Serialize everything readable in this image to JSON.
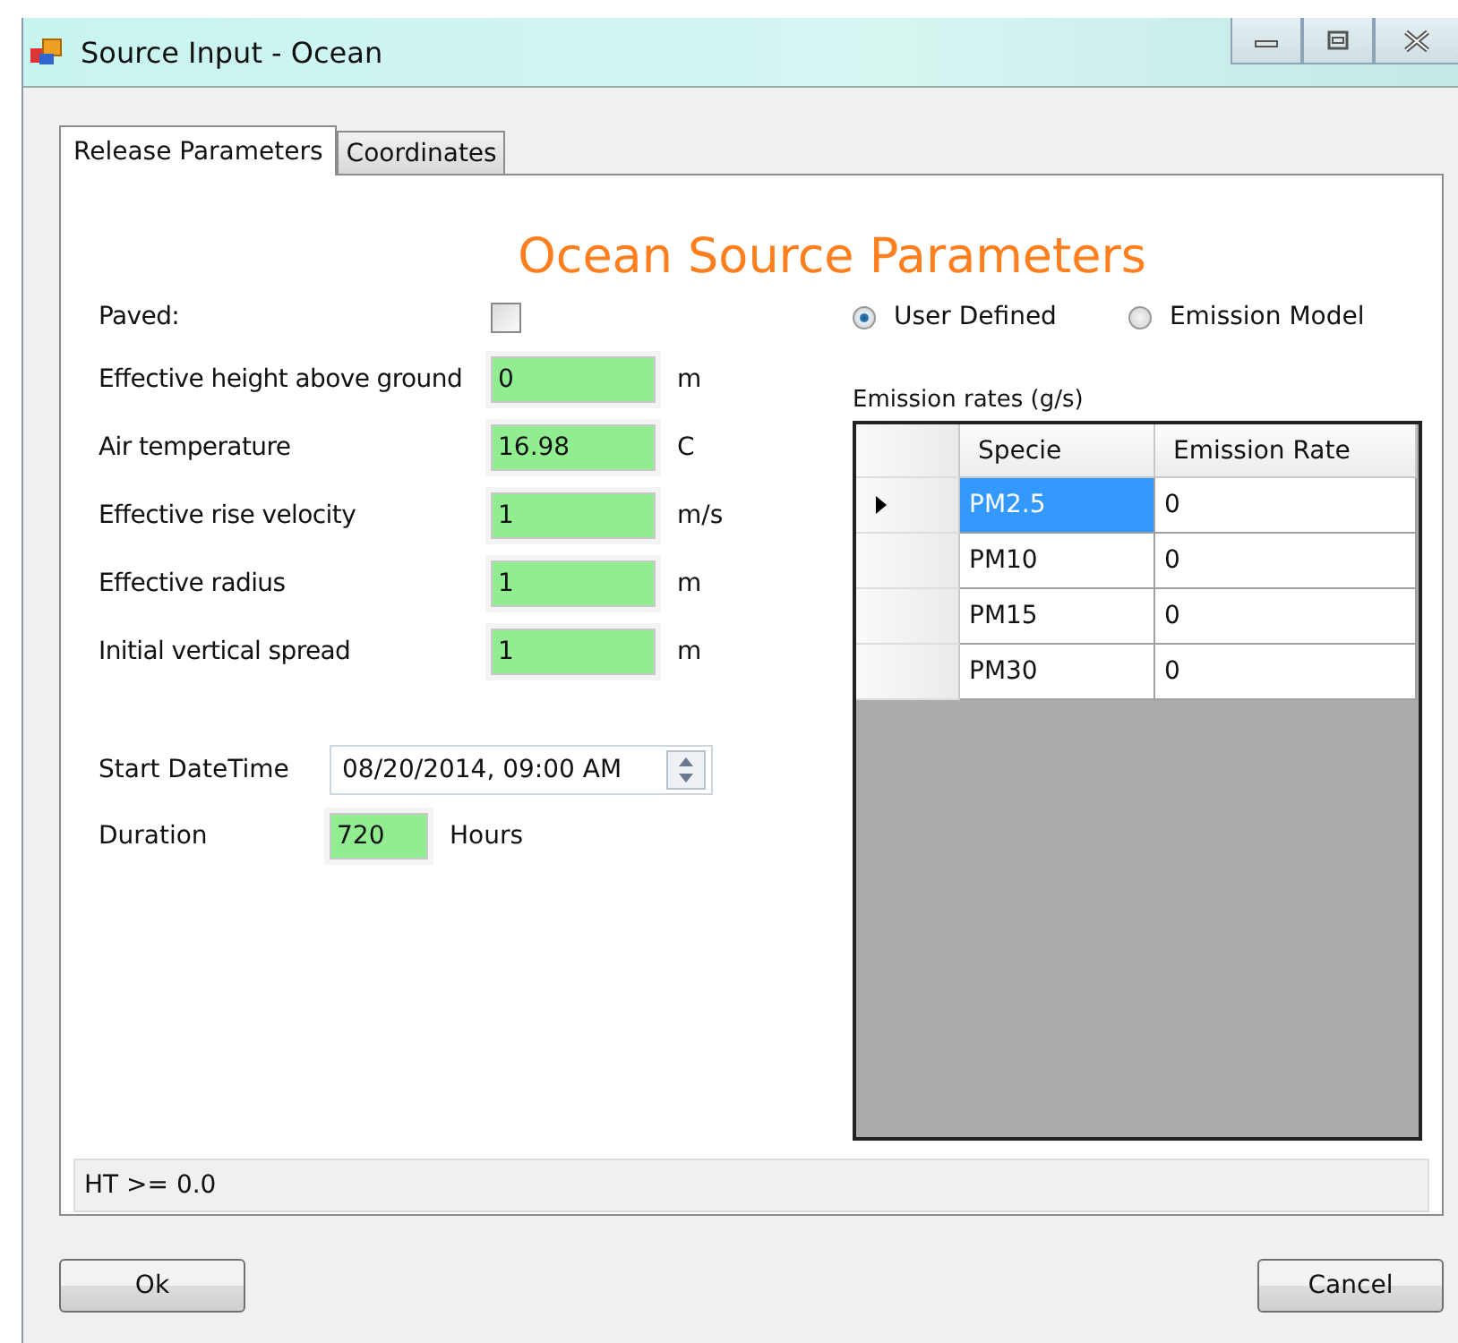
{
  "window": {
    "title": "Source Input - Ocean"
  },
  "tabs": [
    {
      "label": "Release Parameters",
      "selected": true
    },
    {
      "label": "Coordinates",
      "selected": false
    }
  ],
  "heading": "Ocean Source Parameters",
  "paved": {
    "label": "Paved:",
    "checked": false
  },
  "parameters": [
    {
      "label": "Effective height above ground",
      "value": "0",
      "unit": "m"
    },
    {
      "label": "Air temperature",
      "value": "16.98",
      "unit": "C"
    },
    {
      "label": "Effective rise velocity",
      "value": "1",
      "unit": "m/s"
    },
    {
      "label": "Effective radius",
      "value": "1",
      "unit": "m"
    },
    {
      "label": "Initial vertical spread",
      "value": "1",
      "unit": "m"
    }
  ],
  "start_datetime": {
    "label": "Start DateTime",
    "value": "08/20/2014, 09:00 AM"
  },
  "duration": {
    "label": "Duration",
    "value": "720",
    "unit": "Hours"
  },
  "emission_mode": [
    {
      "label": "User Defined",
      "selected": true
    },
    {
      "label": "Emission Model",
      "selected": false
    }
  ],
  "emission_table": {
    "caption": "Emission rates (g/s)",
    "columns": [
      "Specie",
      "Emission Rate"
    ],
    "rows": [
      {
        "specie": "PM2.5",
        "rate": "0",
        "selected": true
      },
      {
        "specie": "PM10",
        "rate": "0",
        "selected": false
      },
      {
        "specie": "PM15",
        "rate": "0",
        "selected": false
      },
      {
        "specie": "PM30",
        "rate": "0",
        "selected": false
      }
    ]
  },
  "status_bar": "HT >= 0.0",
  "buttons": [
    "Ok",
    "Cancel"
  ]
}
